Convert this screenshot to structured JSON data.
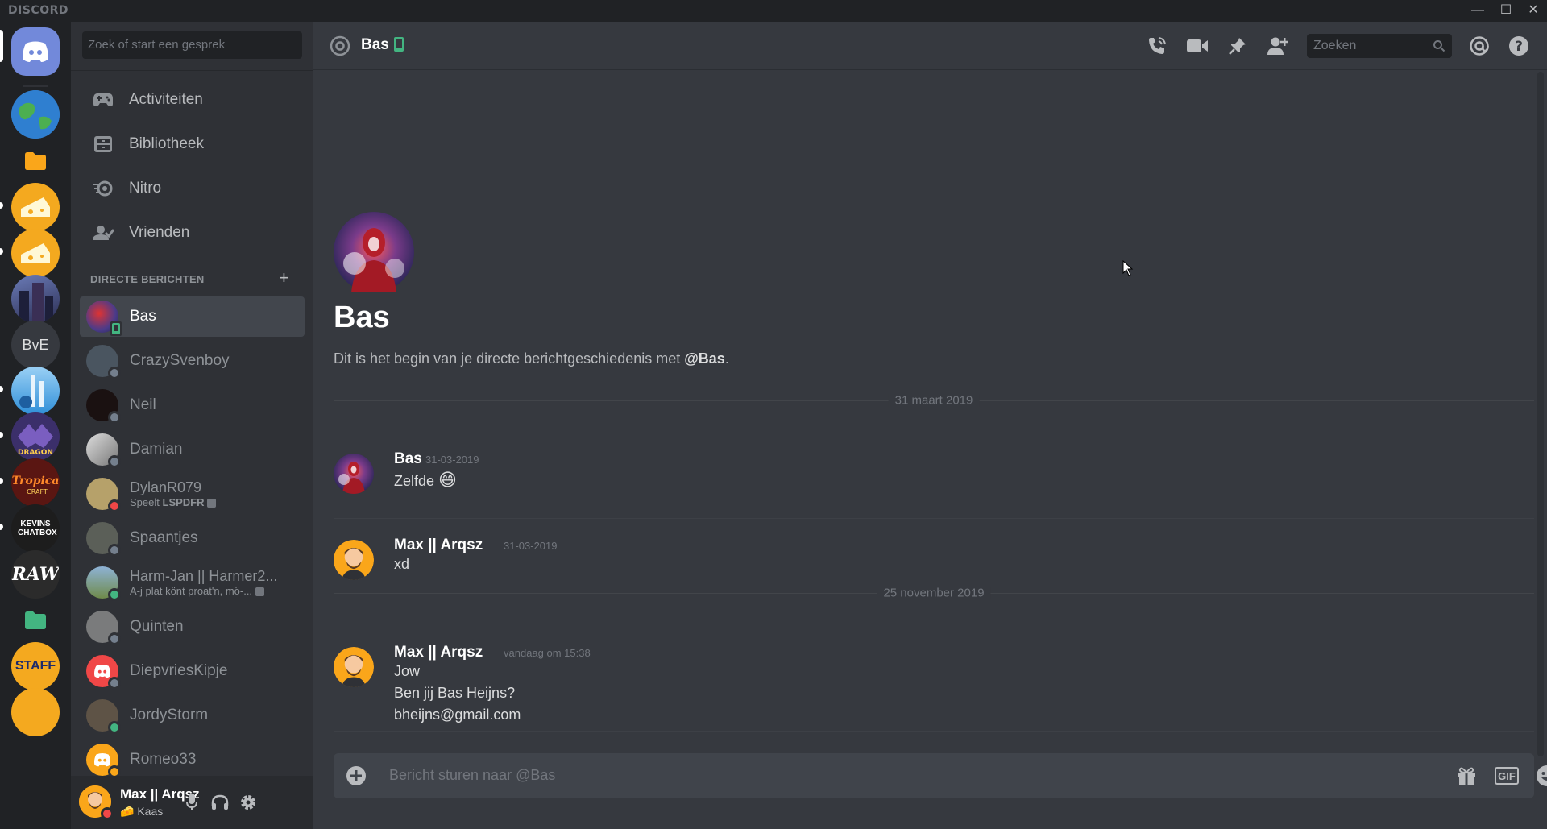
{
  "titlebar": {
    "brand": "DISCORD",
    "minimize": "—",
    "maximize": "☐",
    "close": "✕"
  },
  "rail": {
    "servers": [
      {
        "name": "home",
        "color": "#7289da"
      },
      {
        "name": "earth",
        "color": "#3d7fc7"
      },
      {
        "name": "folder",
        "color": "#faa61a"
      },
      {
        "name": "kaas-1",
        "color": "#f4a91f",
        "unread": true
      },
      {
        "name": "kaas-2",
        "color": "#f4a91f",
        "unread": true
      },
      {
        "name": "city",
        "color": "#4a4d78"
      },
      {
        "name": "BvE",
        "label": "BvE",
        "color": "#36393f"
      },
      {
        "name": "globe-tower",
        "color": "#2f8fd8",
        "unread": true
      },
      {
        "name": "dragon",
        "color": "#3b2f6a",
        "unread": true
      },
      {
        "name": "tropica",
        "color": "#6a1d1a",
        "unread": true
      },
      {
        "name": "kevins-chatbox",
        "label": "KEVINS CHATBOX",
        "color": "#1d1d1d",
        "unread": true
      },
      {
        "name": "raw",
        "label": "RAW",
        "color": "#2b2b2b"
      },
      {
        "name": "folder-green",
        "color": "#43b581"
      },
      {
        "name": "staff",
        "label": "STAFF",
        "color": "#f4a91f"
      }
    ]
  },
  "sidebar": {
    "search_placeholder": "Zoek of start een gesprek",
    "nav": [
      {
        "label": "Activiteiten",
        "icon": "gamepad-icon"
      },
      {
        "label": "Bibliotheek",
        "icon": "library-icon"
      },
      {
        "label": "Nitro",
        "icon": "nitro-icon"
      },
      {
        "label": "Vrienden",
        "icon": "friends-icon"
      }
    ],
    "dm_header": "DIRECTE BERICHTEN",
    "dms": [
      {
        "name": "Bas",
        "status": "mobile",
        "active": true,
        "color": "#3c3f75"
      },
      {
        "name": "CrazySvenboy",
        "status": "off",
        "color": "#4a5560"
      },
      {
        "name": "Neil",
        "status": "off",
        "color": "#1a1111"
      },
      {
        "name": "Damian",
        "status": "off",
        "color": "#b9bbbe"
      },
      {
        "name": "DylanR079",
        "status": "dnd",
        "sub": "Speelt",
        "sub_bold": "LSPDFR",
        "color": "#b6a16a"
      },
      {
        "name": "Spaantjes",
        "status": "off",
        "color": "#5b5f58"
      },
      {
        "name": "Harm-Jan || Harmer2...",
        "status": "on",
        "sub": "A-j plat könt proat'n, mö-...",
        "color": "#6f8a4a"
      },
      {
        "name": "Quinten",
        "status": "off",
        "color": "#7a7b7c"
      },
      {
        "name": "DiepvriesKipje",
        "status": "off",
        "color": "#f04747"
      },
      {
        "name": "JordyStorm",
        "status": "on",
        "color": "#5e5346"
      },
      {
        "name": "Romeo33",
        "status": "idle",
        "color": "#faa61a"
      }
    ],
    "user": {
      "name": "Max || Arqsz",
      "status": "Kaas"
    }
  },
  "chat": {
    "header_title": "Bas",
    "search_placeholder": "Zoeken",
    "welcome_name": "Bas",
    "welcome_text_pre": "Dit is het begin van je directe berichtgeschiedenis met ",
    "welcome_text_mention": "@Bas",
    "welcome_text_post": ".",
    "dividers": [
      "31 maart 2019",
      "25 november 2019"
    ],
    "messages": [
      {
        "author": "Bas",
        "time": "31-03-2019",
        "lines": [
          "Zelfde"
        ],
        "emoji": "😄"
      },
      {
        "author": "Max || Arqsz",
        "time": "31-03-2019",
        "lines": [
          "xd"
        ]
      },
      {
        "author": "Max || Arqsz",
        "time": "vandaag om 15:38",
        "lines": [
          "Jow",
          "Ben jij Bas Heijns?",
          "bheijns@gmail.com"
        ]
      }
    ],
    "composer_placeholder": "Bericht sturen naar @Bas",
    "gif_label": "GIF"
  }
}
